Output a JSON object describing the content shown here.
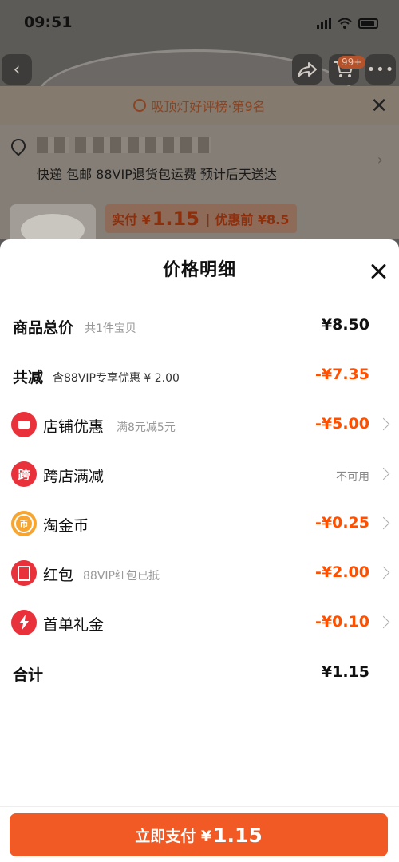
{
  "status": {
    "time": "09:51"
  },
  "background": {
    "rank_text": "吸顶灯好评榜·第9名",
    "shipping": "快递 包邮 88VIP退货包运费 预计后天送达",
    "cart_badge": "99+",
    "pay_prefix": "实付 ¥",
    "pay_big": "1.15",
    "before_discount": "优惠前 ¥8.5"
  },
  "sheet": {
    "title": "价格明细",
    "rows": [
      {
        "label": "商品总价",
        "sub": "共1件宝贝",
        "value": "¥8.50"
      },
      {
        "label": "共减",
        "sub": "含88VIP专享优惠 ¥ 2.00",
        "value": "-¥7.35"
      },
      {
        "label": "店铺优惠",
        "sub": "满8元减5元",
        "value": "-¥5.00",
        "icon": "store-icon"
      },
      {
        "label": "跨店满减",
        "status": "不可用",
        "icon": "cross-store-icon",
        "icon_text": "跨"
      },
      {
        "label": "淘金币",
        "value": "-¥0.25",
        "icon": "taojinbi-coin-icon"
      },
      {
        "label": "红包",
        "sub": "88VIP红包已抵",
        "value": "-¥2.00",
        "icon": "red-packet-icon"
      },
      {
        "label": "首单礼金",
        "value": "-¥0.10",
        "icon": "lightning-icon"
      },
      {
        "label": "合计",
        "value": "¥1.15"
      }
    ]
  },
  "pay_button": {
    "label": "立即支付 ¥",
    "amount": "1.15"
  },
  "colors": {
    "accent": "#ff5000",
    "button": "#f15a24"
  }
}
